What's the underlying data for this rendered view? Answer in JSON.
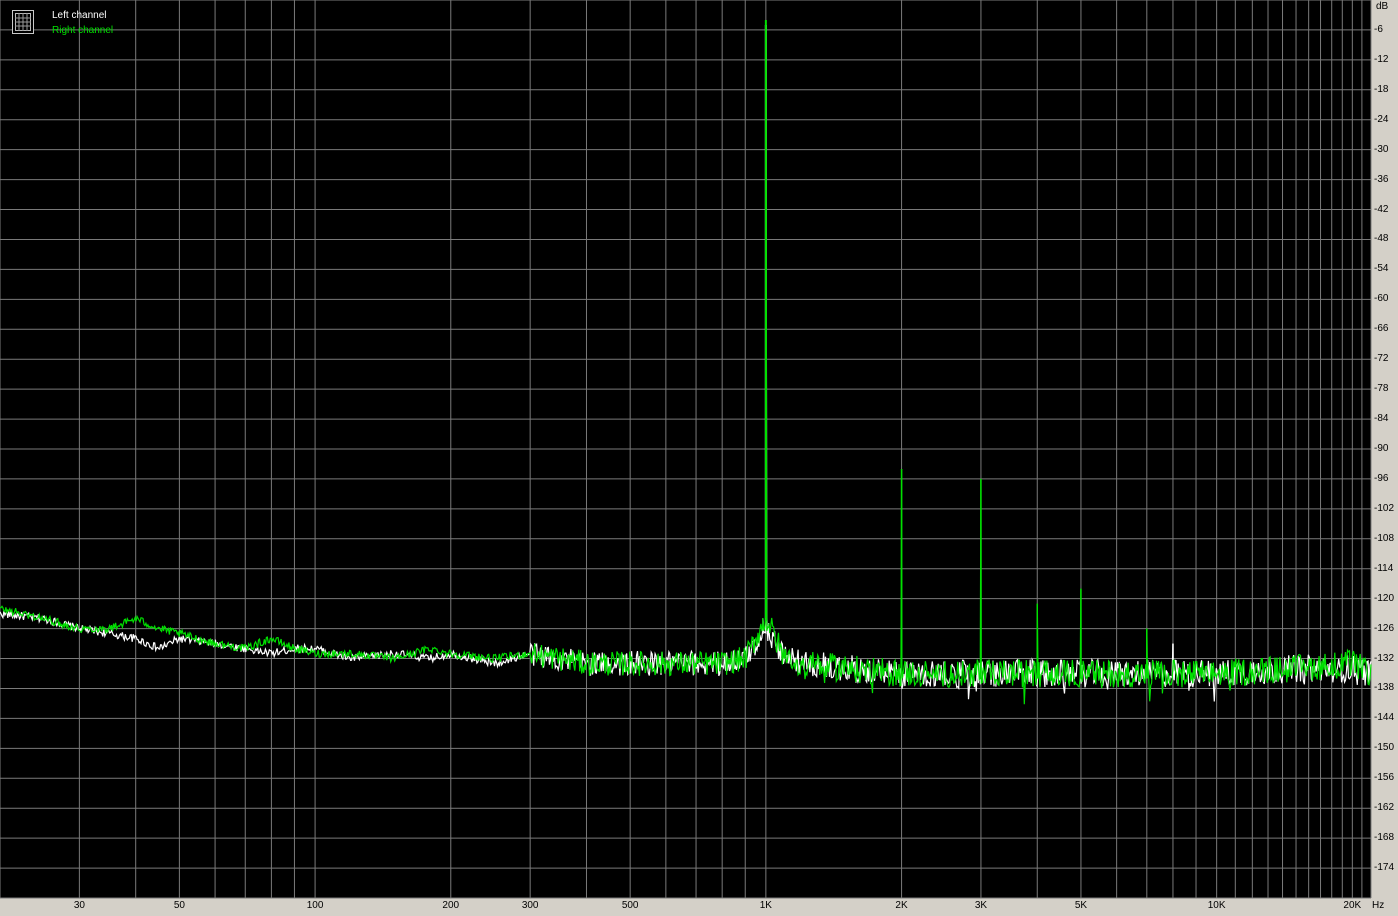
{
  "colors": {
    "background": "#000000",
    "grid": "#7a7a7a",
    "left_channel": "#ffffff",
    "right_channel": "#00e000",
    "frame": "#d4d0c8"
  },
  "legend": {
    "icon": "spectrum-grid-icon",
    "left_label": "Left channel",
    "right_label": "Right channel"
  },
  "chart_data": {
    "type": "line",
    "title": "",
    "xlabel": "Hz",
    "ylabel": "dB",
    "x_scale": "log",
    "xlim": [
      20,
      22000
    ],
    "ylim": [
      -180,
      0
    ],
    "grid": true,
    "legend_position": "top-left",
    "x_tick_labels": [
      {
        "value": 30,
        "label": "30"
      },
      {
        "value": 50,
        "label": "50"
      },
      {
        "value": 100,
        "label": "100"
      },
      {
        "value": 200,
        "label": "200"
      },
      {
        "value": 300,
        "label": "300"
      },
      {
        "value": 500,
        "label": "500"
      },
      {
        "value": 1000,
        "label": "1K"
      },
      {
        "value": 2000,
        "label": "2K"
      },
      {
        "value": 3000,
        "label": "3K"
      },
      {
        "value": 5000,
        "label": "5K"
      },
      {
        "value": 10000,
        "label": "10K"
      },
      {
        "value": 20000,
        "label": "20K"
      }
    ],
    "y_ticks": [
      -6,
      -12,
      -18,
      -24,
      -30,
      -36,
      -42,
      -48,
      -54,
      -60,
      -66,
      -72,
      -78,
      -84,
      -90,
      -96,
      -102,
      -108,
      -114,
      -120,
      -126,
      -132,
      -138,
      -144,
      -150,
      -156,
      -162,
      -168,
      -174
    ],
    "series": [
      {
        "name": "Left channel",
        "color": "#ffffff",
        "points": [
          [
            20,
            -123
          ],
          [
            25,
            -124
          ],
          [
            30,
            -126
          ],
          [
            35,
            -127
          ],
          [
            40,
            -128
          ],
          [
            45,
            -130
          ],
          [
            50,
            -128
          ],
          [
            60,
            -129
          ],
          [
            70,
            -130
          ],
          [
            80,
            -131
          ],
          [
            90,
            -130
          ],
          [
            100,
            -130
          ],
          [
            120,
            -132
          ],
          [
            150,
            -131
          ],
          [
            180,
            -132
          ],
          [
            200,
            -131
          ],
          [
            250,
            -133
          ],
          [
            300,
            -131
          ],
          [
            400,
            -133
          ],
          [
            500,
            -133
          ],
          [
            600,
            -133
          ],
          [
            700,
            -133
          ],
          [
            800,
            -133
          ],
          [
            900,
            -132
          ],
          [
            950,
            -129
          ],
          [
            1000,
            -125
          ],
          [
            1050,
            -129
          ],
          [
            1100,
            -132
          ],
          [
            1200,
            -133
          ],
          [
            1500,
            -134
          ],
          [
            2000,
            -135
          ],
          [
            2500,
            -135
          ],
          [
            3000,
            -135
          ],
          [
            4000,
            -135
          ],
          [
            5000,
            -135
          ],
          [
            7000,
            -135
          ],
          [
            8000,
            -135
          ],
          [
            10000,
            -135
          ],
          [
            15000,
            -134
          ],
          [
            20000,
            -134
          ],
          [
            22000,
            -135
          ]
        ],
        "peaks": [
          {
            "x": 1000,
            "y": -5
          },
          {
            "x": 8000,
            "y": -129
          }
        ]
      },
      {
        "name": "Right channel",
        "color": "#00e000",
        "points": [
          [
            20,
            -122
          ],
          [
            25,
            -124
          ],
          [
            30,
            -126
          ],
          [
            35,
            -126
          ],
          [
            40,
            -124
          ],
          [
            45,
            -126
          ],
          [
            50,
            -127
          ],
          [
            60,
            -129
          ],
          [
            70,
            -130
          ],
          [
            80,
            -128
          ],
          [
            90,
            -130
          ],
          [
            100,
            -131
          ],
          [
            120,
            -131
          ],
          [
            150,
            -132
          ],
          [
            180,
            -130
          ],
          [
            200,
            -131
          ],
          [
            250,
            -132
          ],
          [
            300,
            -131
          ],
          [
            400,
            -133
          ],
          [
            500,
            -133
          ],
          [
            600,
            -133
          ],
          [
            700,
            -133
          ],
          [
            800,
            -133
          ],
          [
            900,
            -132
          ],
          [
            950,
            -128
          ],
          [
            1000,
            -124
          ],
          [
            1050,
            -128
          ],
          [
            1100,
            -132
          ],
          [
            1200,
            -133
          ],
          [
            1500,
            -134
          ],
          [
            2000,
            -135
          ],
          [
            2500,
            -135
          ],
          [
            3000,
            -135
          ],
          [
            4000,
            -135
          ],
          [
            5000,
            -135
          ],
          [
            7000,
            -135
          ],
          [
            10000,
            -135
          ],
          [
            15000,
            -134
          ],
          [
            20000,
            -133
          ],
          [
            22000,
            -135
          ]
        ],
        "peaks": [
          {
            "x": 1000,
            "y": -4
          },
          {
            "x": 2000,
            "y": -94
          },
          {
            "x": 3000,
            "y": -96
          },
          {
            "x": 4000,
            "y": -121
          },
          {
            "x": 5000,
            "y": -118
          },
          {
            "x": 7000,
            "y": -126
          }
        ]
      }
    ]
  }
}
